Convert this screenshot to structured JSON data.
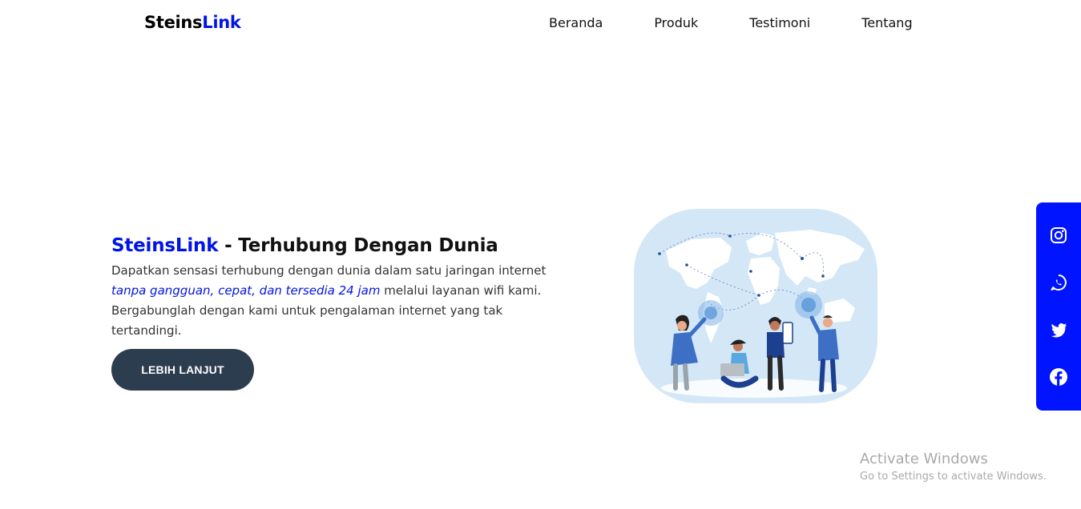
{
  "brand": {
    "part1": "Steins",
    "part2": "Link"
  },
  "nav": {
    "items": [
      "Beranda",
      "Produk",
      "Testimoni",
      "Tentang"
    ]
  },
  "hero": {
    "title_accent": "SteinsLink",
    "title_rest": " - Terhubung Dengan Dunia",
    "desc_before": "Dapatkan sensasi terhubung dengan dunia dalam satu jaringan internet ",
    "desc_highlight": "tanpa gangguan, cepat, dan tersedia 24 jam",
    "desc_after": " melalui layanan wifi kami. Bergabunglah dengan kami untuk pengalaman internet yang tak tertandingi.",
    "cta_label": "LEBIH LANJUT"
  },
  "social": {
    "icons": [
      "instagram-icon",
      "whatsapp-icon",
      "twitter-icon",
      "facebook-icon"
    ]
  },
  "colors": {
    "accent": "#0014e6",
    "sidebar": "#0014ff",
    "button": "#2d3d50",
    "illustration_bg": "#d3e7f7"
  },
  "watermark": {
    "line1": "Activate Windows",
    "line2": "Go to Settings to activate Windows."
  }
}
